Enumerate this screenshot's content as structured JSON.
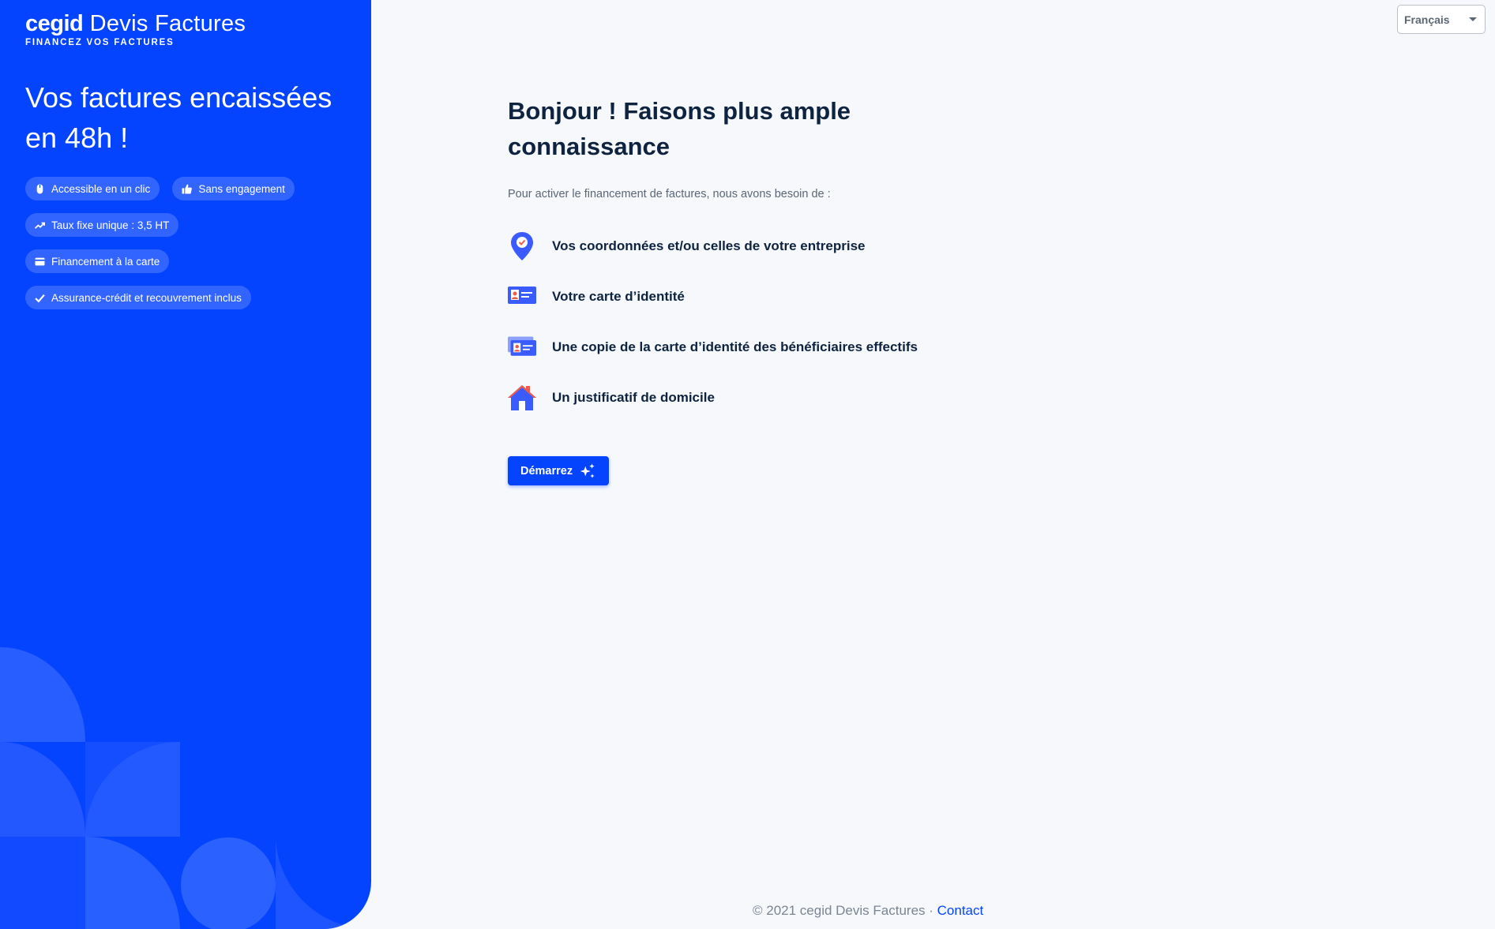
{
  "brand": {
    "name_bold": "cegid",
    "name_product": "Devis Factures",
    "tagline": "FINANCEZ VOS FACTURES"
  },
  "sidebar": {
    "headline": "Vos factures encaissées en 48h !",
    "pills": [
      {
        "label": "Accessible en un clic",
        "icon": "mouse-icon"
      },
      {
        "label": "Sans engagement",
        "icon": "thumbs-up-icon"
      },
      {
        "label": "Taux fixe unique : 3,5 HT",
        "icon": "trend-up-icon"
      },
      {
        "label": "Financement à la carte",
        "icon": "card-icon"
      },
      {
        "label": "Assurance-crédit et recouvrement inclus",
        "icon": "check-icon"
      }
    ]
  },
  "language": {
    "selected": "Français"
  },
  "main": {
    "title": "Bonjour ! Faisons plus ample connaissance",
    "intro": "Pour activer le financement de factures, nous avons besoin de :",
    "requirements": [
      {
        "label": "Vos coordonnées et/ou celles de votre entreprise",
        "icon": "location-pin-icon"
      },
      {
        "label": "Votre carte d’identité",
        "icon": "id-card-icon"
      },
      {
        "label": "Une copie de la carte d’identité des bénéficiaires effectifs",
        "icon": "id-cards-stack-icon"
      },
      {
        "label": "Un justificatif de domicile",
        "icon": "house-icon"
      }
    ],
    "cta_label": "Démarrez",
    "cta_icon": "sparkles-icon"
  },
  "footer": {
    "copyright": "© 2021 cegid Devis Factures ·",
    "contact": "Contact"
  },
  "colors": {
    "brand_blue": "#0544ff",
    "text_dark": "#0d2340",
    "text_muted": "#5b6675",
    "accent_orange": "#f05a4a",
    "background": "#f6f8fc"
  }
}
